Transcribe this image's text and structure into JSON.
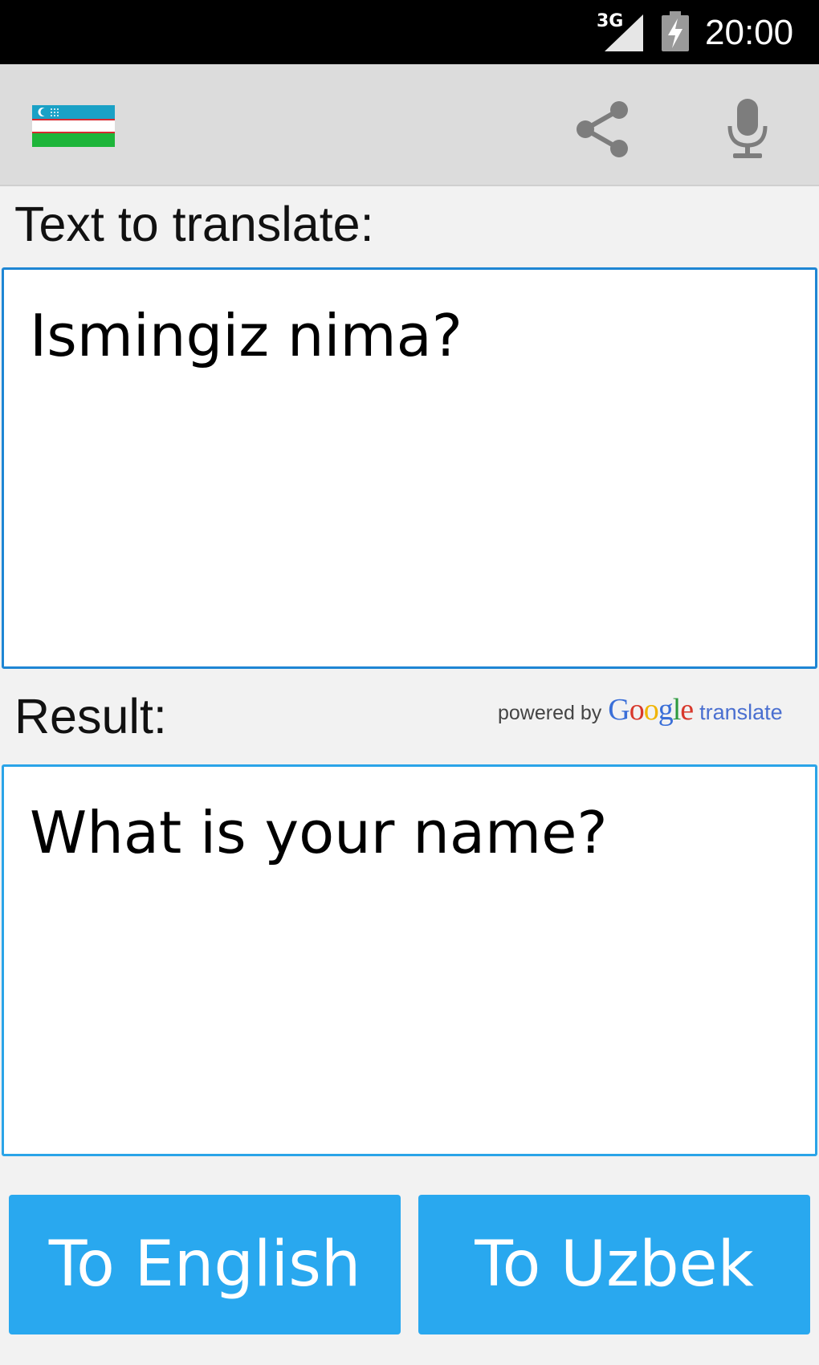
{
  "status_bar": {
    "network": "3G",
    "time": "20:00"
  },
  "toolbar": {
    "flag_icon": "uzbekistan-flag-icon",
    "share_icon": "share-icon",
    "mic_icon": "microphone-icon"
  },
  "input": {
    "label": "Text to translate:",
    "value": "Ismingiz nima?"
  },
  "result": {
    "label": "Result:",
    "value": "What is your name?",
    "powered_by": "powered by",
    "google_letters": [
      "G",
      "o",
      "o",
      "g",
      "l",
      "e"
    ],
    "google_colors": [
      "#3a6fd8",
      "#d8382b",
      "#f0b400",
      "#3a6fd8",
      "#2e9a3f",
      "#d8382b"
    ],
    "translate_word": "translate"
  },
  "buttons": {
    "to_english": "To English",
    "to_uzbek": "To Uzbek"
  },
  "colors": {
    "accent": "#29a8ef",
    "border": "#1e86d4",
    "toolbar": "#dcdcdc"
  }
}
